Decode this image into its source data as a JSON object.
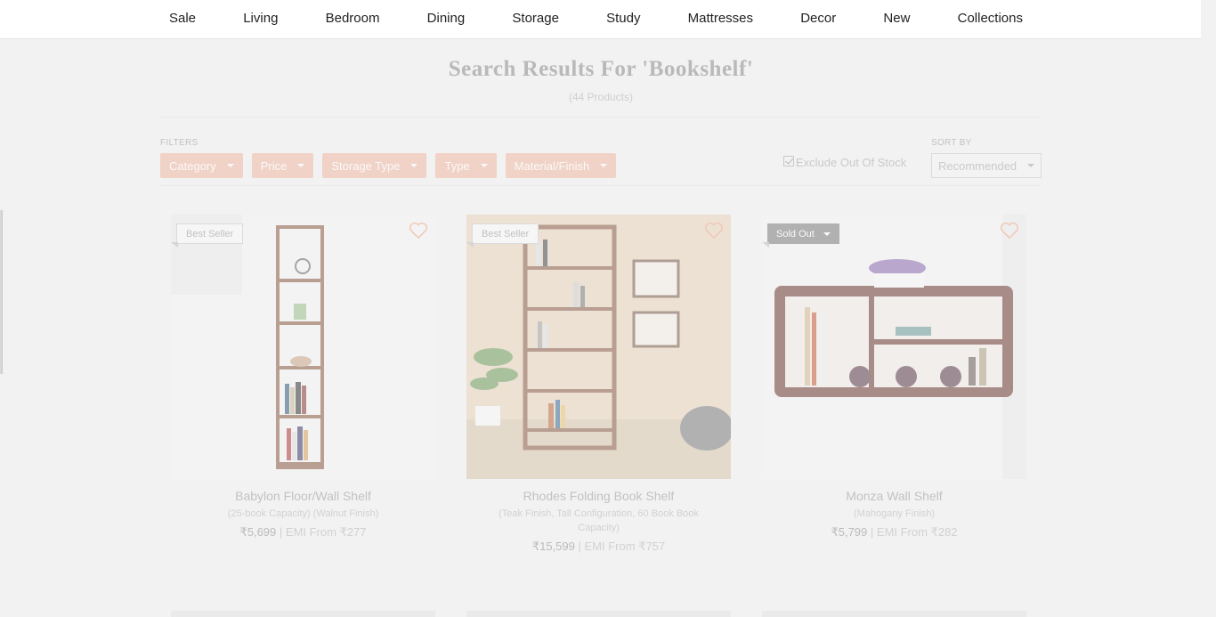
{
  "nav": {
    "items": [
      "Sale",
      "Living",
      "Bedroom",
      "Dining",
      "Storage",
      "Study",
      "Mattresses",
      "Decor",
      "New",
      "Collections"
    ]
  },
  "results": {
    "title": "Search Results For 'Bookshelf'",
    "count": "(44 Products)"
  },
  "filters": {
    "label": "FILTERS",
    "buttons": [
      "Category",
      "Price",
      "Storage Type",
      "Type",
      "Material/Finish"
    ],
    "exclude_label": "Exclude Out Of Stock",
    "exclude_checked": true
  },
  "sort": {
    "label": "SORT BY",
    "selected": "Recommended"
  },
  "colors": {
    "filter_bg": "#f1b9a3",
    "page_bg": "#f2f2f2"
  },
  "products": [
    {
      "badge": "Best Seller",
      "badge_type": "best",
      "name": "Babylon Floor/Wall Shelf",
      "desc": "(25-book Capacity) (Walnut Finish)",
      "price": "₹5,699",
      "emi": "| EMI From ₹277"
    },
    {
      "badge": "Best Seller",
      "badge_type": "best",
      "name": "Rhodes Folding Book Shelf",
      "desc": "(Teak Finish, Tall Configuration, 60 Book Book Capacity)",
      "price": "₹15,599",
      "emi": "| EMI From ₹757"
    },
    {
      "badge": "Sold Out",
      "badge_type": "sold",
      "name": "Monza Wall Shelf",
      "desc": "(Mahogany Finish)",
      "price": "₹5,799",
      "emi": "| EMI From ₹282"
    }
  ]
}
